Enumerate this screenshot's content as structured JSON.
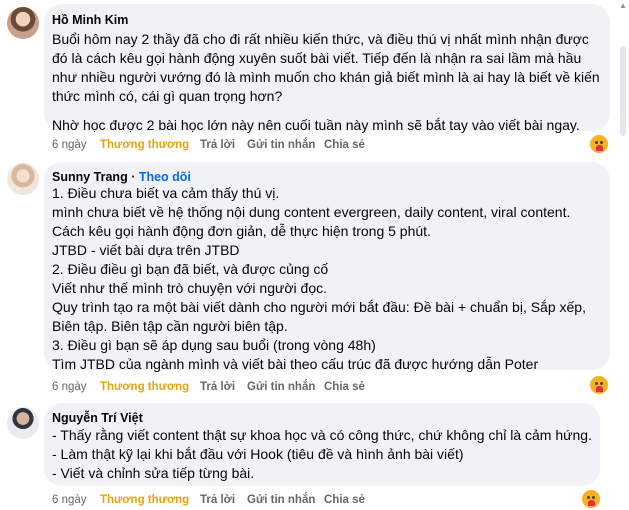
{
  "comments": [
    {
      "author": "Hồ Minh Kim",
      "follow": "",
      "lines": [
        "Buổi hôm nay 2 thầy đã cho đi rất nhiều kiến thức, và điều thú vị nhất mình nhận được",
        "đó là cách kêu gọi hành động xuyên suốt bài viết. Tiếp đến là nhận ra sai lầm mà hầu",
        "như nhiều người vướng đó là mình muốn cho khán giả biết mình là ai hay là biết về kiến",
        "thức mình có, cái gì quan trọng hơn?",
        "",
        "Nhờ học được 2 bài học lớn này nên cuối tuần này mình sẽ bắt tay vào viết bài ngay."
      ],
      "time": "6 ngày",
      "like": "Thương thương",
      "reply": "Trả lời",
      "send": "Gửi tin nhắn",
      "share": "Chia sẻ"
    },
    {
      "author": "Sunny Trang",
      "follow": "Theo dõi",
      "lines": [
        "1. Điều chưa biết va cảm thấy thú vị.",
        "mình chưa biết về hệ thống nội dung content evergreen, daily content, viral content.",
        "Cách kêu gọi hành động đơn giản, dễ thực hiện trong 5 phút.",
        "JTBD - viết bài dựa trên JTBD",
        "2. Điều điều gì bạn đã biết, và được củng cố",
        "Viết như thế mình trò chuyện với người đọc.",
        "Quy trình tạo ra một bài viết dành cho người mới bắt đầu: Đề bài + chuẩn bị, Sắp xếp,",
        "Biên tập. Biên tập cần người biên tập.",
        "3. Điều gì bạn sẽ áp dụng sau buổi (trong vòng 48h)",
        "Tìm JTBD của ngành mình và viết bài theo cấu trúc đã được hướng dẫn Poter"
      ],
      "time": "6 ngày",
      "like": "Thương thương",
      "reply": "Trả lời",
      "send": "Gửi tin nhắn",
      "share": "Chia sẻ"
    },
    {
      "author": "Nguyễn Trí Việt",
      "follow": "",
      "lines": [
        "- Thấy rằng viết content thật sự khoa học và có công thức, chứ không chỉ là cảm hứng.",
        "- Làm thật kỹ lại khi bắt đầu với Hook (tiêu đề và hình ảnh bài viết)",
        "- Viết và chỉnh sửa tiếp từng bài."
      ],
      "time": "6 ngày",
      "like": "Thương thương",
      "reply": "Trả lời",
      "send": "Gửi tin nhắn",
      "share": "Chia sẻ"
    }
  ],
  "colors": {
    "bubble": "#f0f2f5",
    "like": "#e8a211",
    "follow": "#0866ff",
    "meta": "#65676b"
  }
}
